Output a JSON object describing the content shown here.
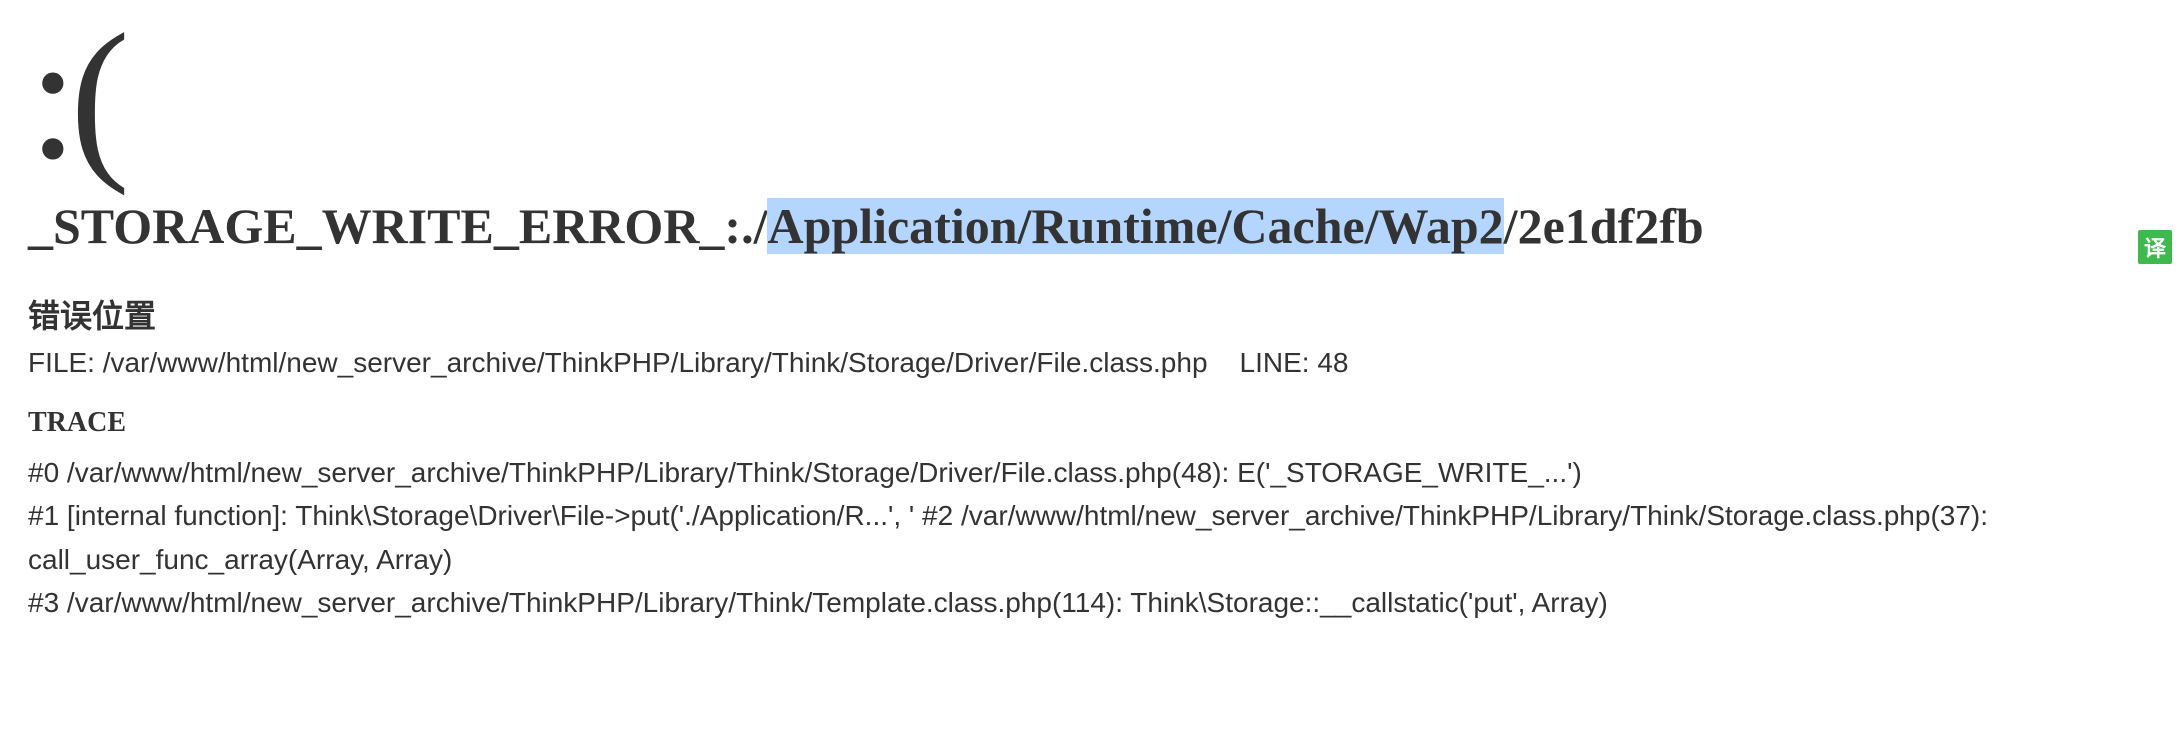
{
  "sad_face": ":(",
  "error": {
    "prefix": "_STORAGE_WRITE_ERROR_:./",
    "highlighted": "Application/Runtime/Cache/Wap2",
    "suffix": "/2e1df2fb"
  },
  "location": {
    "heading": "错误位置",
    "file_label": "FILE: ",
    "file_path": "/var/www/html/new_server_archive/ThinkPHP/Library/Think/Storage/Driver/File.class.php",
    "line_label": "LINE: ",
    "line_number": "48"
  },
  "trace": {
    "heading": "TRACE",
    "lines": [
      "#0 /var/www/html/new_server_archive/ThinkPHP/Library/Think/Storage/Driver/File.class.php(48): E('_STORAGE_WRITE_...')",
      "#1 [internal function]: Think\\Storage\\Driver\\File->put('./Application/R...', ' #2 /var/www/html/new_server_archive/ThinkPHP/Library/Think/Storage.class.php(37): call_user_func_array(Array, Array)",
      "#3 /var/www/html/new_server_archive/ThinkPHP/Library/Think/Template.class.php(114): Think\\Storage::__callstatic('put', Array)"
    ]
  },
  "translate_badge": "译"
}
